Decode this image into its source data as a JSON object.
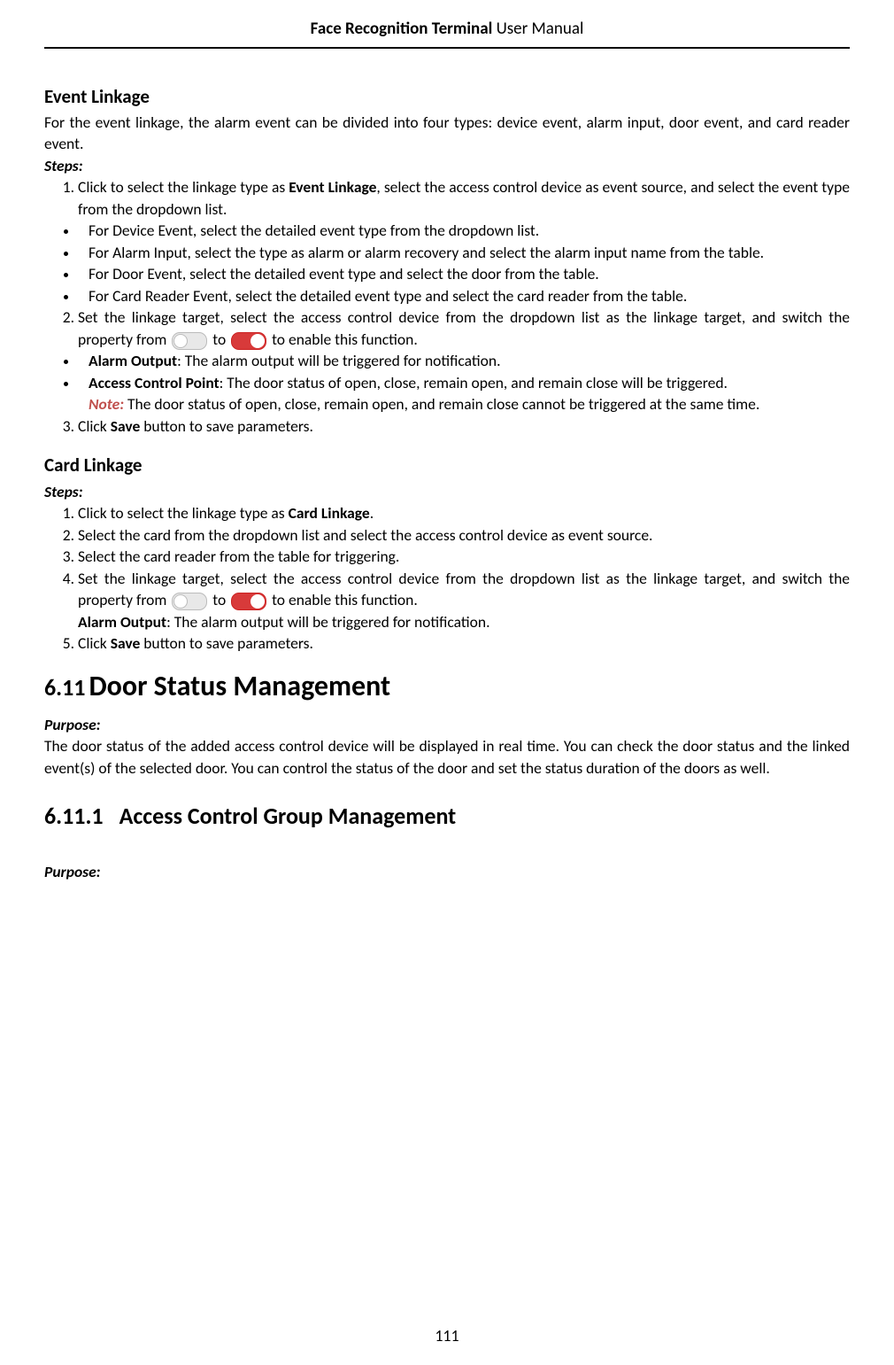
{
  "header": {
    "title_bold": "Face Recognition Terminal",
    "title_regular": "User Manual"
  },
  "footer": {
    "page_number": "111"
  },
  "event_linkage": {
    "heading": "Event Linkage",
    "intro": "For the event linkage, the alarm event can be divided into four types: device event, alarm input, door event, and card reader event.",
    "steps_label": "Steps:",
    "step1_pre": "Click to select the linkage type as ",
    "step1_bold": "Event Linkage",
    "step1_post": ", select the access control device as event source, and select the event type from the dropdown list.",
    "bullets1": {
      "b1": "For Device Event, select the detailed event type from the dropdown list.",
      "b2": "For Alarm Input, select the type as alarm or alarm recovery and select the alarm input name from the table.",
      "b3": "For Door Event, select the detailed event type and select the door from the table.",
      "b4": "For Card Reader Event, select the detailed event type and select the card reader from the table."
    },
    "step2_pre": "Set the linkage target, select the access control device from the dropdown list as the linkage target, and switch the property from ",
    "step2_mid": " to ",
    "step2_post": " to enable this function.",
    "bullets2": {
      "b1_bold": "Alarm Output",
      "b1_text": ": The alarm output will be triggered for notification.",
      "b2_bold": "Access Control Point",
      "b2_text": ": The door status of open, close, remain open, and remain close will be triggered.",
      "b2_note_label": "Note:",
      "b2_note_text": " The door status of open, close, remain open, and remain close cannot be triggered at the same time."
    },
    "step3_pre": "Click ",
    "step3_bold": "Save",
    "step3_post": " button to save parameters."
  },
  "card_linkage": {
    "heading": "Card Linkage",
    "steps_label": "Steps:",
    "step1_pre": "Click to select the linkage type as ",
    "step1_bold": "Card Linkage",
    "step1_post": ".",
    "step2": "Select the card from the dropdown list and select the access control device as event source.",
    "step3": "Select the card reader from the table for triggering.",
    "step4_pre": "Set the linkage target, select the access control device from the dropdown list as the linkage target, and switch the property from ",
    "step4_mid": " to ",
    "step4_post": " to enable this function.",
    "step4_sub_bold": "Alarm Output",
    "step4_sub_text": ": The alarm output will be triggered for notification.",
    "step5_pre": "Click ",
    "step5_bold": "Save",
    "step5_post": " button to save parameters."
  },
  "section611": {
    "num": "6.11",
    "title": "Door Status Management",
    "purpose_label": "Purpose:",
    "purpose_text": "The door status of the added access control device will be displayed in real time. You can check the door status and the linked event(s) of the selected door. You can control the status of the door and set the status duration of the doors as well."
  },
  "section6111": {
    "num": "6.11.1",
    "title": "Access Control Group Management",
    "purpose_label": "Purpose:"
  }
}
